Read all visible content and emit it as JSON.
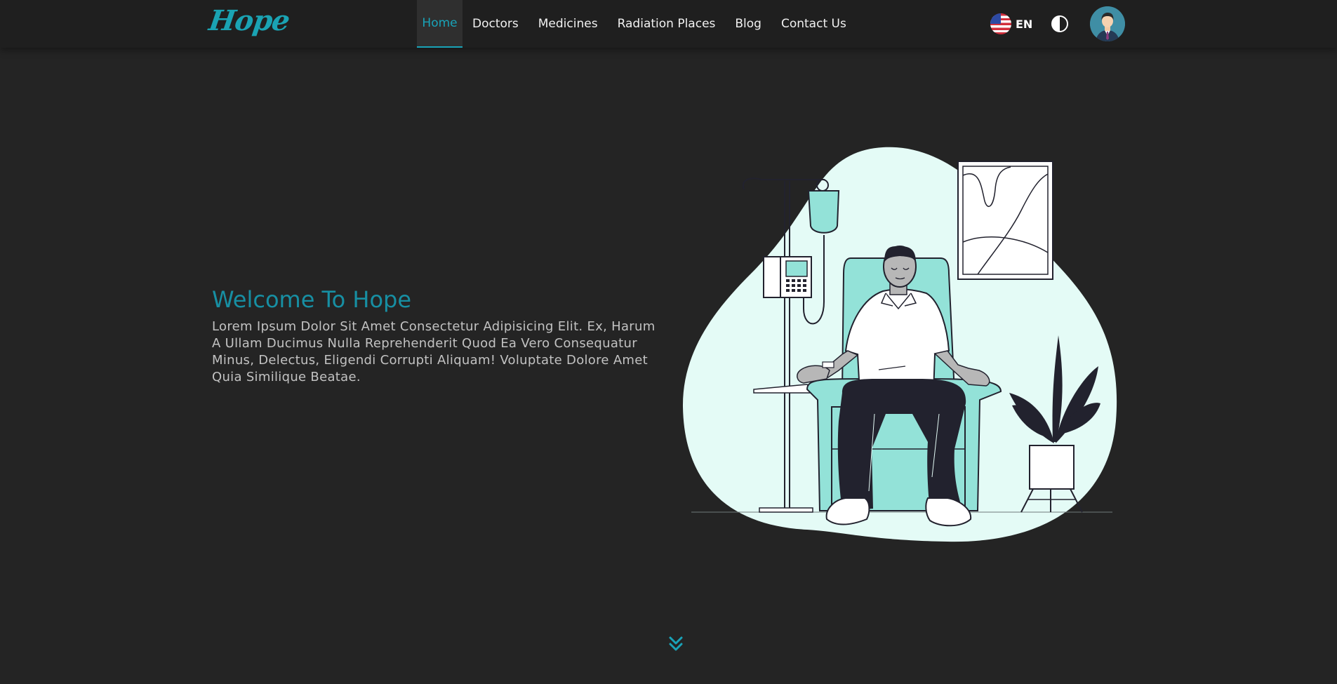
{
  "brand": {
    "logo_text": "Hope"
  },
  "nav": {
    "items": [
      {
        "label": "Home",
        "active": true
      },
      {
        "label": "Doctors",
        "active": false
      },
      {
        "label": "Medicines",
        "active": false
      },
      {
        "label": "Radiation Places",
        "active": false
      },
      {
        "label": "Blog",
        "active": false
      },
      {
        "label": "Contact Us",
        "active": false
      }
    ],
    "language_label": "EN",
    "language_icon": "us-flag-icon",
    "theme_icon": "contrast-icon",
    "avatar_icon": "user-avatar-icon"
  },
  "hero": {
    "title": "Welcome To Hope",
    "text": "Lorem Ipsum Dolor Sit Amet Consectetur Adipisicing Elit. Ex, Harum A Ullam Ducimus Nulla Reprehenderit Quod Ea Vero Consequatur Minus, Delectus, Eligendi Corrupti Aliquam! Voluptate Dolore Amet Quia Similique Beatae.",
    "illustration_icon": "patient-iv-chair-illustration",
    "scroll_icon": "double-chevron-down-icon"
  },
  "colors": {
    "background": "#242424",
    "navbar": "#1f1f1f",
    "accent": "#19a3b8",
    "blob": "#e4fbf6",
    "mint": "#93e2d8",
    "ink": "#22222e"
  }
}
